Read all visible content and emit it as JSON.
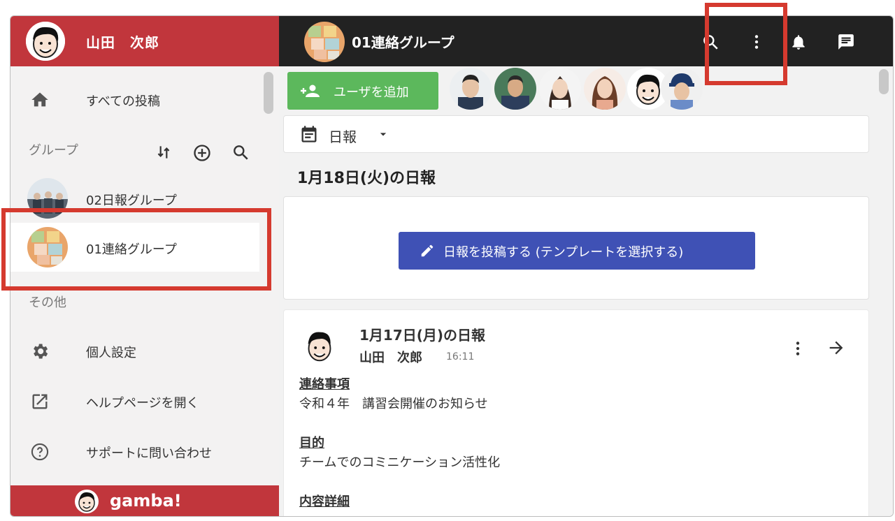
{
  "user": {
    "name": "山田　次郎"
  },
  "sidebar": {
    "all_posts": "すべての投稿",
    "groups_label": "グループ",
    "groups": [
      {
        "name": "02日報グループ"
      },
      {
        "name": "01連絡グループ"
      }
    ],
    "other_label": "その他",
    "other_items": [
      {
        "label": "個人設定",
        "icon": "gear-icon"
      },
      {
        "label": "ヘルプページを開く",
        "icon": "open-in-new-icon"
      },
      {
        "label": "サポートに問い合わせ",
        "icon": "help-circle-icon"
      }
    ],
    "brand": "gamba!"
  },
  "header": {
    "group_title": "01連絡グループ"
  },
  "main": {
    "add_user_label": "ユーザを追加",
    "report_type": "日報",
    "today_title": "1月18日(火)の日報",
    "post_button": "日報を投稿する (テンプレートを選択する)",
    "report": {
      "title": "1月17日(月)の日報",
      "author": "山田　次郎",
      "time": "16:11",
      "fields": [
        {
          "heading": "連絡事項",
          "value": "令和４年　講習会開催のお知らせ"
        },
        {
          "heading": "目的",
          "value": "チームでのコミニケーション活性化"
        },
        {
          "heading": "内容詳細",
          "value": ""
        }
      ]
    }
  },
  "colors": {
    "brand_red": "#c1363c",
    "topbar": "#222222",
    "add_user_green": "#5cb85c",
    "post_blue": "#3f51b5",
    "highlight": "#d53a2f"
  }
}
